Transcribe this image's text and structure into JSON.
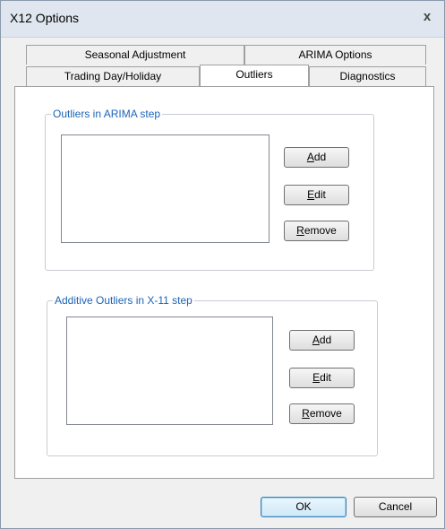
{
  "window": {
    "title": "X12 Options",
    "close_glyph": "x"
  },
  "tabs": {
    "row1": [
      "Seasonal Adjustment",
      "ARIMA Options"
    ],
    "row2": [
      "Trading Day/Holiday",
      "Outliers",
      "Diagnostics"
    ],
    "active": "Outliers"
  },
  "groups": {
    "arima": {
      "label": "Outliers in ARIMA step",
      "buttons": {
        "add_accel": "A",
        "add_rest": "dd",
        "edit_accel": "E",
        "edit_rest": "dit",
        "remove_accel": "R",
        "remove_rest": "emove"
      }
    },
    "x11": {
      "label": "Additive Outliers in X-11 step",
      "buttons": {
        "add_accel": "A",
        "add_rest": "dd",
        "edit_accel": "E",
        "edit_rest": "dit",
        "remove_accel": "R",
        "remove_rest": "emove"
      }
    }
  },
  "footer": {
    "ok_label": "OK",
    "cancel_label": "Cancel"
  }
}
